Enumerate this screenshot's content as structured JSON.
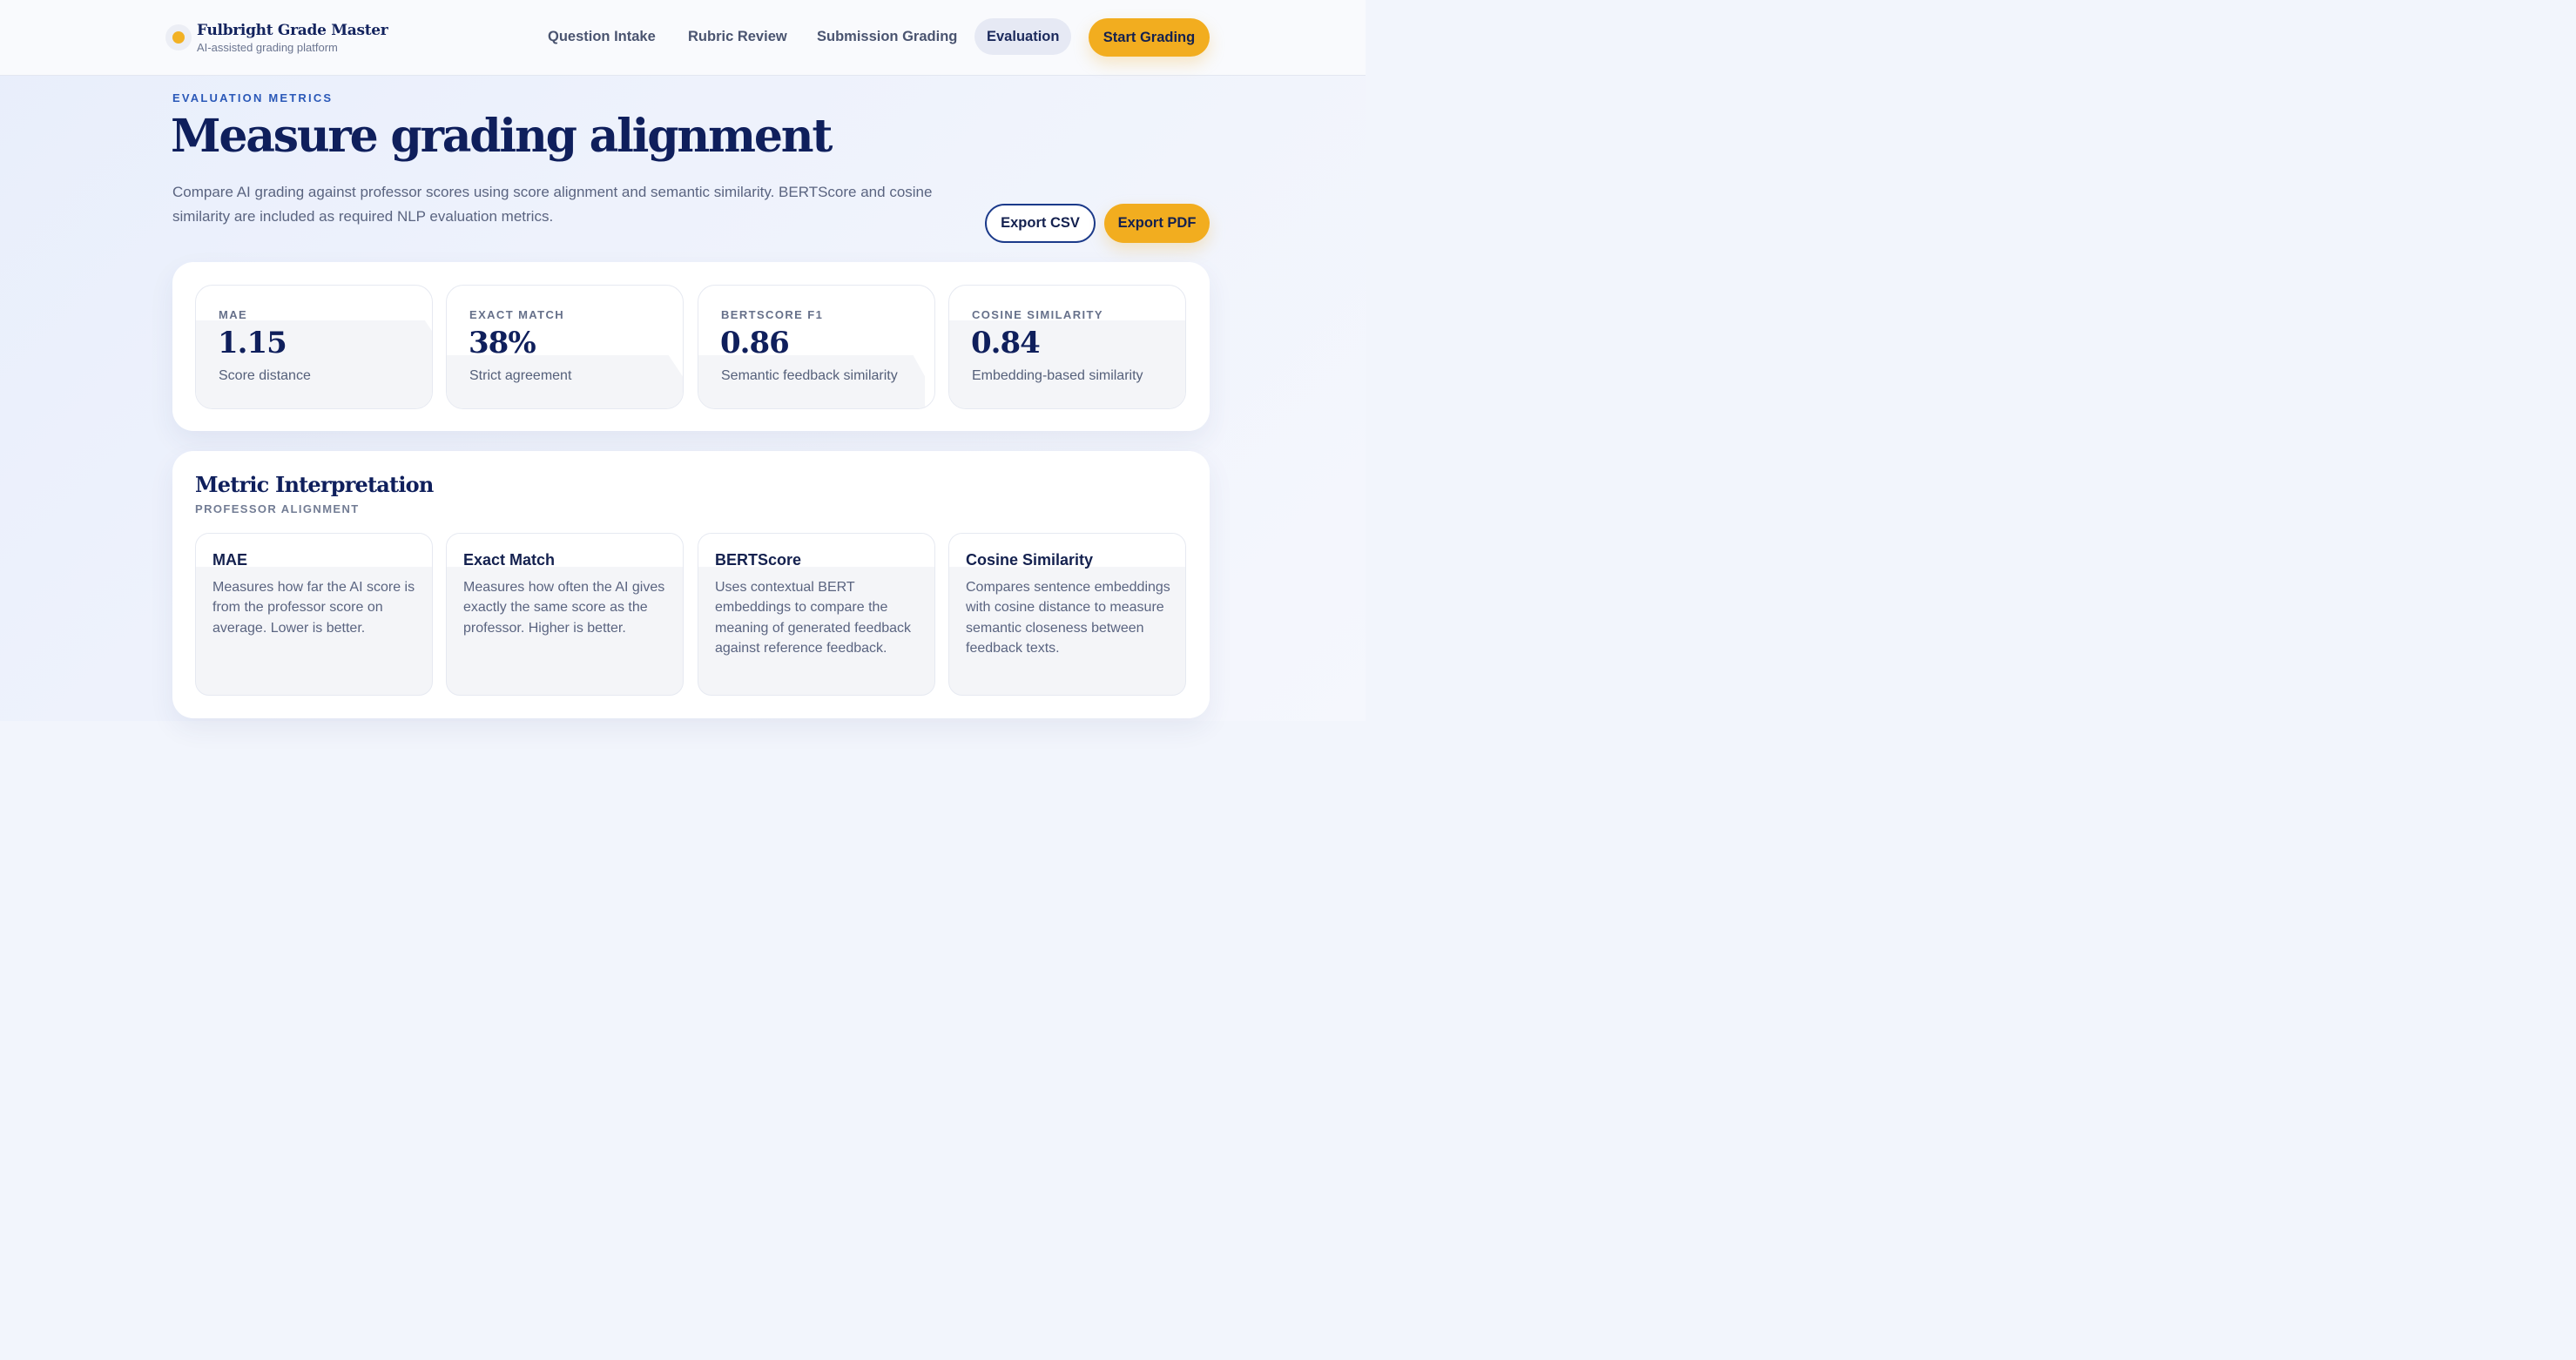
{
  "brand": {
    "name": "Fulbright Grade Master",
    "tagline": "AI-assisted grading platform"
  },
  "nav": {
    "items": [
      "Question Intake",
      "Rubric Review",
      "Submission Grading",
      "Evaluation"
    ],
    "active": "Evaluation",
    "cta": "Start Grading"
  },
  "hero": {
    "eyebrow": "EVALUATION METRICS",
    "title": "Measure grading alignment",
    "description": "Compare AI grading against professor scores using score alignment and semantic similarity. BERTScore and cosine similarity are included as required NLP evaluation metrics.",
    "export_csv": "Export CSV",
    "export_pdf": "Export PDF"
  },
  "metrics": [
    {
      "label": "MAE",
      "value": "1.15",
      "sub": "Score distance"
    },
    {
      "label": "EXACT MATCH",
      "value": "38%",
      "sub": "Strict agreement"
    },
    {
      "label": "BERTSCORE F1",
      "value": "0.86",
      "sub": "Semantic feedback similarity"
    },
    {
      "label": "COSINE SIMILARITY",
      "value": "0.84",
      "sub": "Embedding-based similarity"
    }
  ],
  "interpretation": {
    "title": "Metric Interpretation",
    "subtitle": "PROFESSOR ALIGNMENT",
    "cards": [
      {
        "title": "MAE",
        "text": "Measures how far the AI score is from the professor score on average. Lower is better."
      },
      {
        "title": "Exact Match",
        "text": "Measures how often the AI gives exactly the same score as the professor. Higher is better."
      },
      {
        "title": "BERTScore",
        "text": "Uses contextual BERT embeddings to compare the meaning of generated feedback against reference feedback."
      },
      {
        "title": "Cosine Similarity",
        "text": "Compares sentence embeddings with cosine distance to measure semantic closeness between feedback texts."
      }
    ]
  },
  "colors": {
    "accent": "#f2ad1f",
    "navy": "#0f1f5c",
    "eyebrow_blue": "#2a58b8"
  }
}
